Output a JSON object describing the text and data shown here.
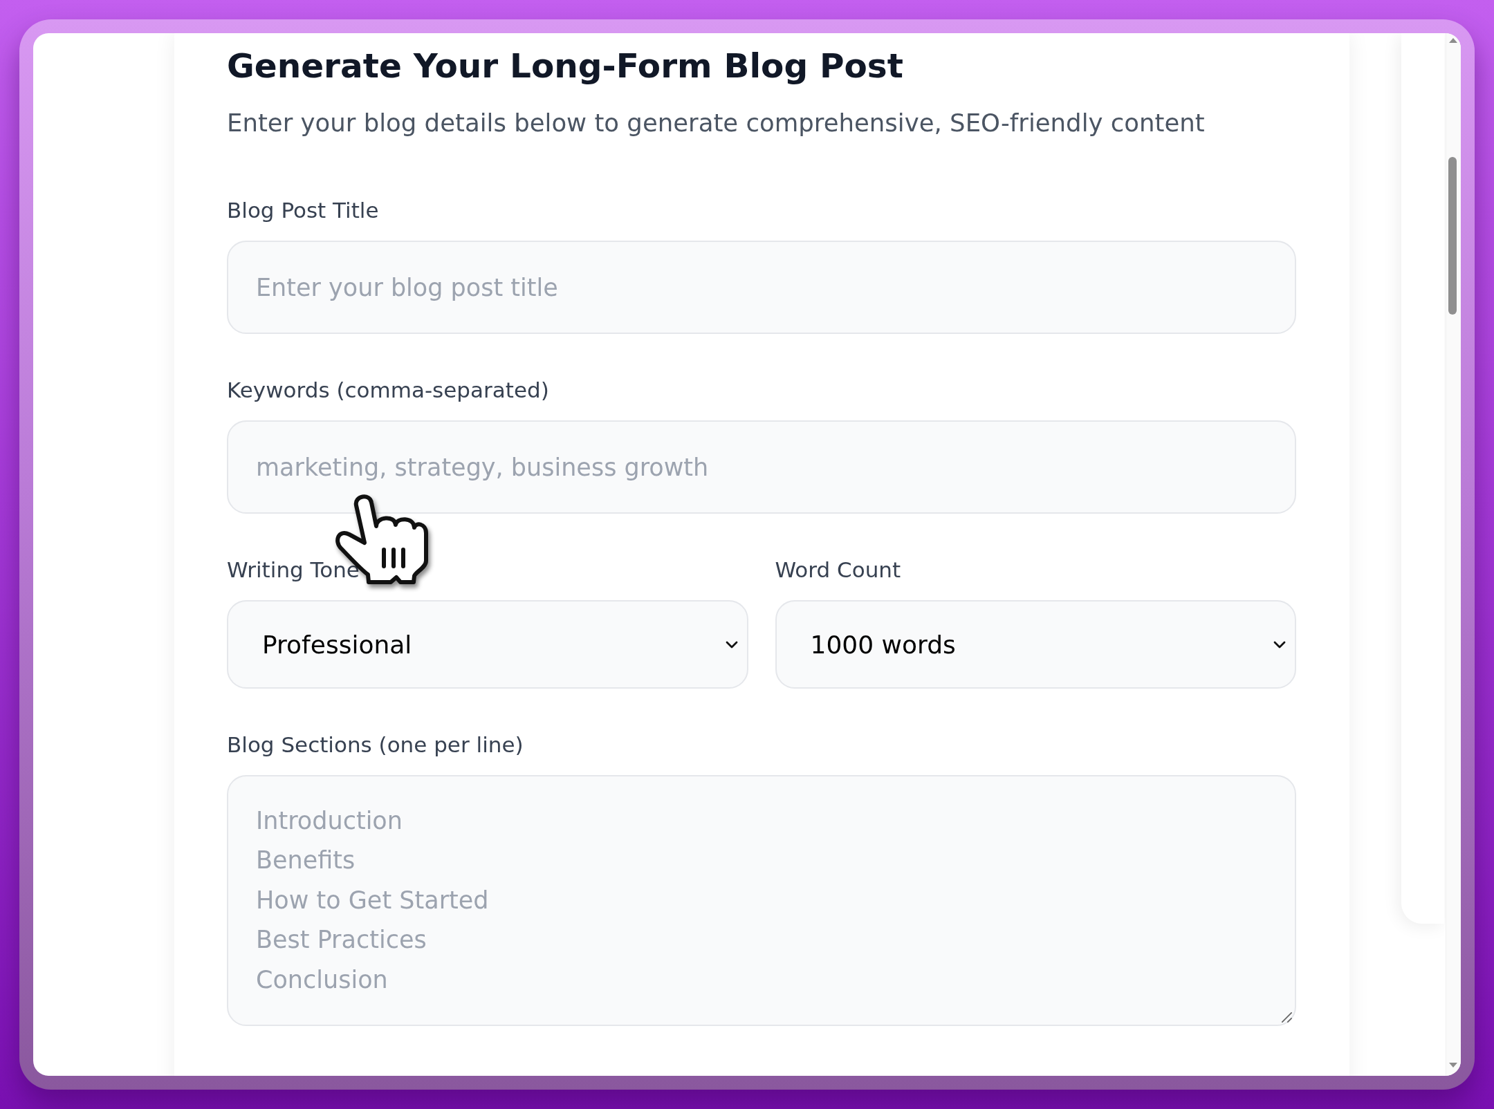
{
  "form": {
    "title": "Generate Your Long-Form Blog Post",
    "subtitle": "Enter your blog details below to generate comprehensive, SEO-friendly content",
    "fields": [
      {
        "kind": "input",
        "label": "Blog Post Title",
        "placeholder": "Enter your blog post title"
      },
      {
        "kind": "input",
        "label": "Keywords (comma-separated)",
        "placeholder": "marketing, strategy, business growth"
      },
      {
        "kind": "row",
        "items": [
          {
            "kind": "select",
            "label": "Writing Tone",
            "value": "Professional"
          },
          {
            "kind": "select",
            "label": "Word Count",
            "value": "1000 words"
          }
        ]
      },
      {
        "kind": "textarea",
        "label": "Blog Sections (one per line)",
        "placeholder": "Introduction\nBenefits\nHow to Get Started\nBest Practices\nConclusion"
      }
    ]
  }
}
